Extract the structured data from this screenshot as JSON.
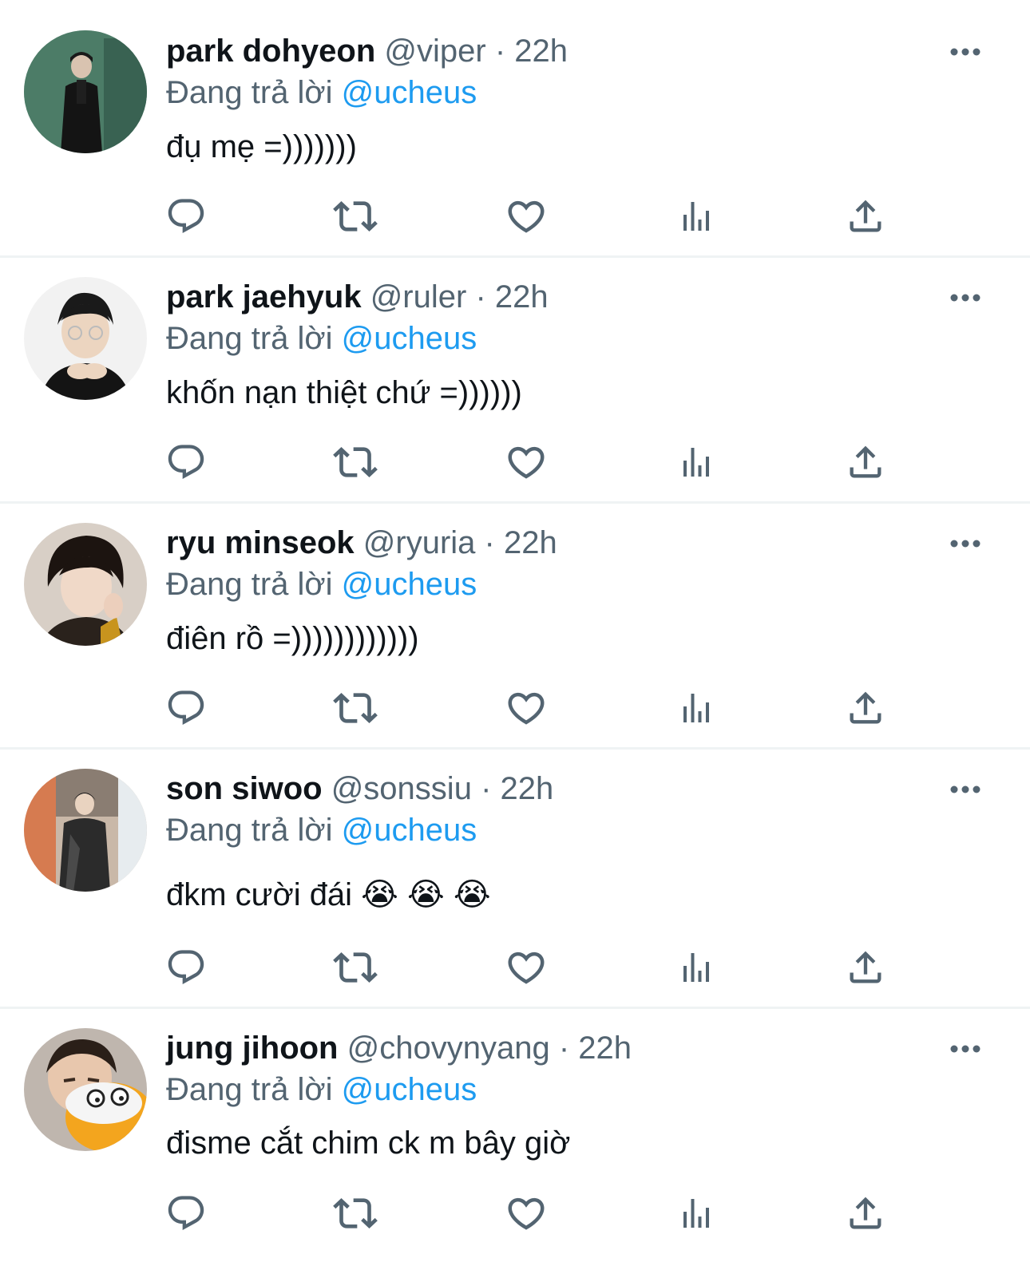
{
  "colors": {
    "text_primary": "#0f1419",
    "text_secondary": "#536471",
    "mention": "#1d9bf0",
    "divider": "#eff3f4",
    "icon": "#536471"
  },
  "tweets": [
    {
      "display_name": "park dohyeon",
      "handle": "@viper",
      "separator": "·",
      "time": "22h",
      "reply_prefix": "Đang trả lời",
      "reply_to": "@ucheus",
      "text": "đụ mẹ =)))))))"
    },
    {
      "display_name": "park jaehyuk",
      "handle": "@ruler",
      "separator": "·",
      "time": "22h",
      "reply_prefix": "Đang trả lời",
      "reply_to": "@ucheus",
      "text": "khốn nạn thiệt chứ =))))))"
    },
    {
      "display_name": "ryu minseok",
      "handle": "@ryuria",
      "separator": "·",
      "time": "22h",
      "reply_prefix": "Đang trả lời",
      "reply_to": "@ucheus",
      "text": "điên rồ =))))))))))))"
    },
    {
      "display_name": "son siwoo",
      "handle": "@sonssiu",
      "separator": "·",
      "time": "22h",
      "reply_prefix": "Đang trả lời",
      "reply_to": "@ucheus",
      "text": "đkm cười đái 😭 😭 😭"
    },
    {
      "display_name": "jung jihoon",
      "handle": "@chovynyang",
      "separator": "·",
      "time": "22h",
      "reply_prefix": "Đang trả lời",
      "reply_to": "@ucheus",
      "text": "đisme cắt chim ck m bây giờ"
    }
  ],
  "action_icons": [
    "reply-icon",
    "retweet-icon",
    "like-icon",
    "views-icon",
    "share-icon"
  ],
  "more_icon": "more-options-icon"
}
